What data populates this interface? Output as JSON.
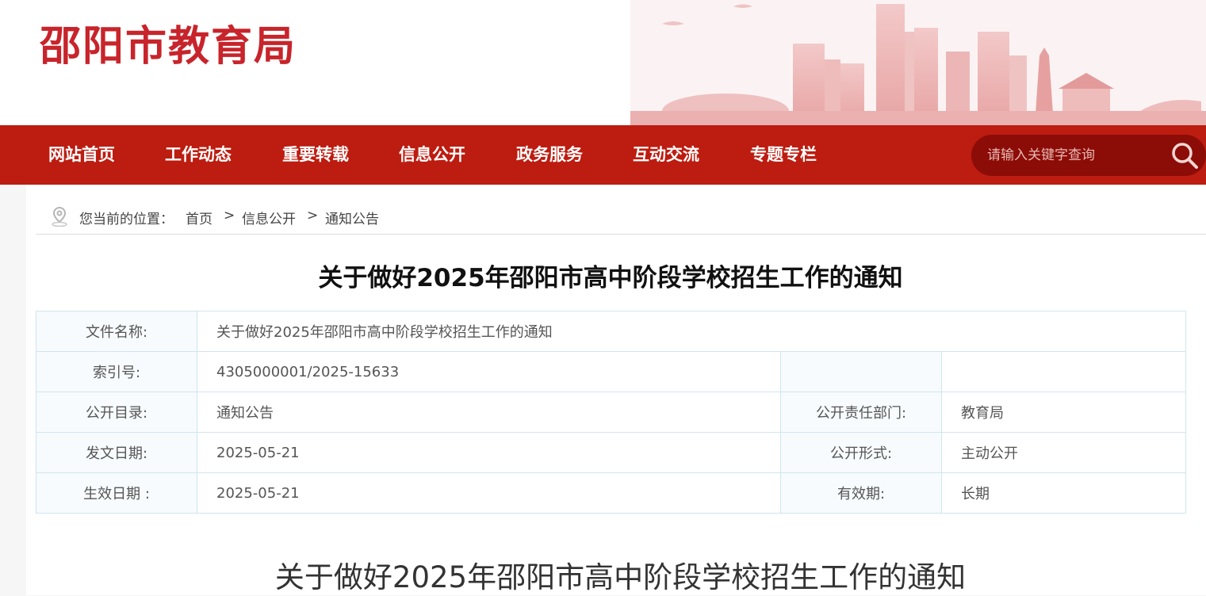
{
  "site": {
    "title": "邵阳市教育局"
  },
  "nav": {
    "items": [
      {
        "label": "网站首页"
      },
      {
        "label": "工作动态"
      },
      {
        "label": "重要转载"
      },
      {
        "label": "信息公开"
      },
      {
        "label": "政务服务"
      },
      {
        "label": "互动交流"
      },
      {
        "label": "专题专栏"
      }
    ]
  },
  "search": {
    "placeholder": "请输入关键字查询"
  },
  "breadcrumb": {
    "prefix": "您当前的位置：",
    "items": [
      "首页",
      "信息公开",
      "通知公告"
    ],
    "separator": ">"
  },
  "document": {
    "title": "关于做好2025年邵阳市高中阶段学校招生工作的通知",
    "meta": {
      "file_name_label": "文件名称:",
      "file_name": "关于做好2025年邵阳市高中阶段学校招生工作的通知",
      "index_label": "索引号:",
      "index": "4305000001/2025-15633",
      "catalog_label": "公开目录:",
      "catalog": "通知公告",
      "dept_label": "公开责任部门:",
      "dept": "教育局",
      "date_label": "发文日期:",
      "date": "2025-05-21",
      "form_label": "公开形式:",
      "form": "主动公开",
      "effective_label": "生效日期 :",
      "effective": "2025-05-21",
      "validity_label": "有效期:",
      "validity": "长期"
    },
    "article_title": "关于做好2025年邵阳市高中阶段学校招生工作的通知"
  },
  "colors": {
    "brand_red": "#bd1c10",
    "title_red": "#c8242b",
    "search_bg": "#8c0c08"
  }
}
